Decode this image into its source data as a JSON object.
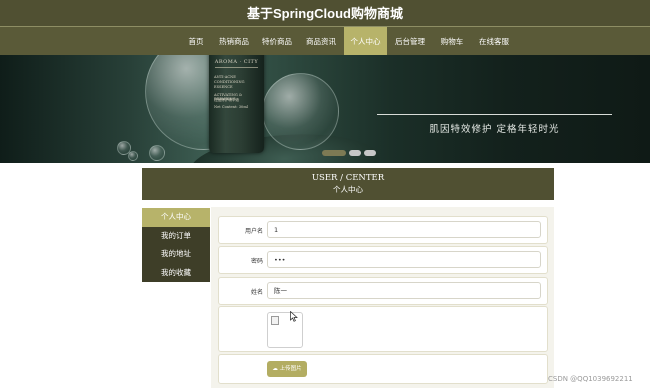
{
  "site": {
    "title": "基于SpringCloud购物商城"
  },
  "nav": {
    "items": [
      "首页",
      "热销商品",
      "特价商品",
      "商品资讯",
      "个人中心",
      "后台管理",
      "购物车",
      "在线客服"
    ],
    "active": "个人中心"
  },
  "banner": {
    "bottle_brand": "AROMA · CITY",
    "bottle_lines": [
      "ANTI-ACNE",
      "CONDITIONING",
      "ESSENCE",
      "ACTIVATING & REPAIRING",
      "祛痘修护精华液",
      "Net Content: 30ml"
    ],
    "slogan": "肌因特效修护   定格年轻时光",
    "slide_count": 3,
    "active_slide": 1
  },
  "section": {
    "title_en": "USER / CENTER",
    "title_cn": "个人中心"
  },
  "sidebar": {
    "items": [
      "个人中心",
      "我的订单",
      "我的地址",
      "我的收藏"
    ],
    "active": "个人中心"
  },
  "form": {
    "username_label": "用户名",
    "username_value": "1",
    "password_label": "密码",
    "password_value": "•••",
    "name_label": "姓名",
    "name_value": "陈一",
    "upload_label": "上传图片"
  },
  "footer": {
    "watermark": "CSDN @QQ1039692211"
  },
  "colors": {
    "header": "#505032",
    "accent": "#b7b36a",
    "sidebar": "#3e3e28"
  }
}
